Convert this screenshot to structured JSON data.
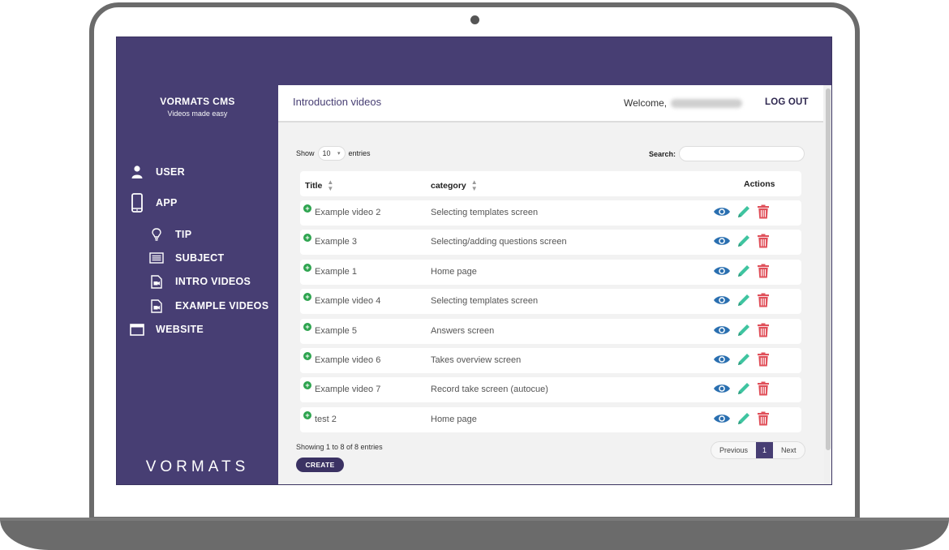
{
  "sidebar": {
    "brand_title": "VORMATS CMS",
    "brand_subtitle": "Videos made easy",
    "items": [
      {
        "label": "USER",
        "icon": "user-icon"
      },
      {
        "label": "APP",
        "icon": "phone-icon"
      },
      {
        "label": "TIP",
        "icon": "lightbulb-icon"
      },
      {
        "label": "SUBJECT",
        "icon": "list-icon"
      },
      {
        "label": "INTRO VIDEOS",
        "icon": "video-file-icon"
      },
      {
        "label": "EXAMPLE VIDEOS",
        "icon": "video-file-icon"
      },
      {
        "label": "WEBSITE",
        "icon": "browser-window-icon"
      }
    ],
    "footer_logo": "VORMATS"
  },
  "header": {
    "title": "Introduction videos",
    "welcome_label": "Welcome,",
    "logout_label": "LOG OUT"
  },
  "controls": {
    "show_label": "Show",
    "entries_value": "10",
    "entries_label": "entries",
    "search_label": "Search:"
  },
  "table": {
    "columns": [
      "Title",
      "category",
      "Actions"
    ],
    "rows": [
      {
        "title": "Example video 2",
        "category": "Selecting templates screen"
      },
      {
        "title": "Example 3",
        "category": "Selecting/adding questions screen"
      },
      {
        "title": "Example 1",
        "category": "Home page"
      },
      {
        "title": "Example video 4",
        "category": "Selecting templates screen"
      },
      {
        "title": "Example 5",
        "category": "Answers screen"
      },
      {
        "title": "Example video 6",
        "category": "Takes overview screen"
      },
      {
        "title": "Example video 7",
        "category": "Record take screen (autocue)"
      },
      {
        "title": "test 2",
        "category": "Home page"
      }
    ]
  },
  "footer": {
    "info": "Showing 1 to 8 of 8 entries",
    "previous_label": "Previous",
    "page": "1",
    "next_label": "Next",
    "create_label": "CREATE"
  },
  "colors": {
    "brand": "#473e73",
    "view": "#2a6fb0",
    "edit": "#3fc4a0",
    "delete": "#e0505a"
  }
}
